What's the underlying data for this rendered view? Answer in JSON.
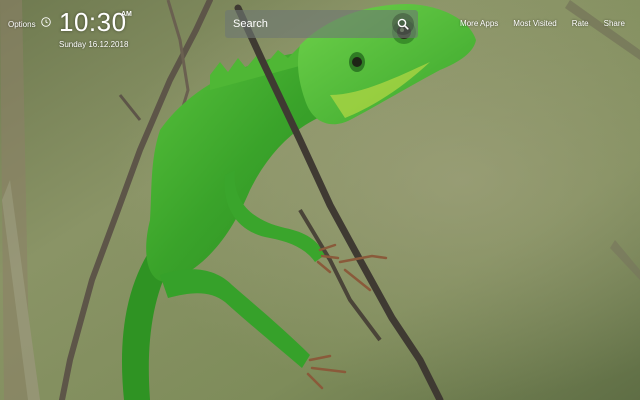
{
  "options_label": "Options",
  "clock": {
    "time": "10:30",
    "ampm": "AM",
    "date": "Sunday 16.12.2018"
  },
  "search": {
    "placeholder": "Search"
  },
  "nav": [
    {
      "label": "More Apps"
    },
    {
      "label": "Most Visited"
    },
    {
      "label": "Rate"
    },
    {
      "label": "Share"
    }
  ],
  "icons": {
    "clock": "clock-icon",
    "search": "magnifier-icon"
  },
  "colors": {
    "background_blur": "#7d8a5e",
    "lizard_green": "#3fae2e",
    "search_box": "rgba(110,120,115,0.62)"
  }
}
